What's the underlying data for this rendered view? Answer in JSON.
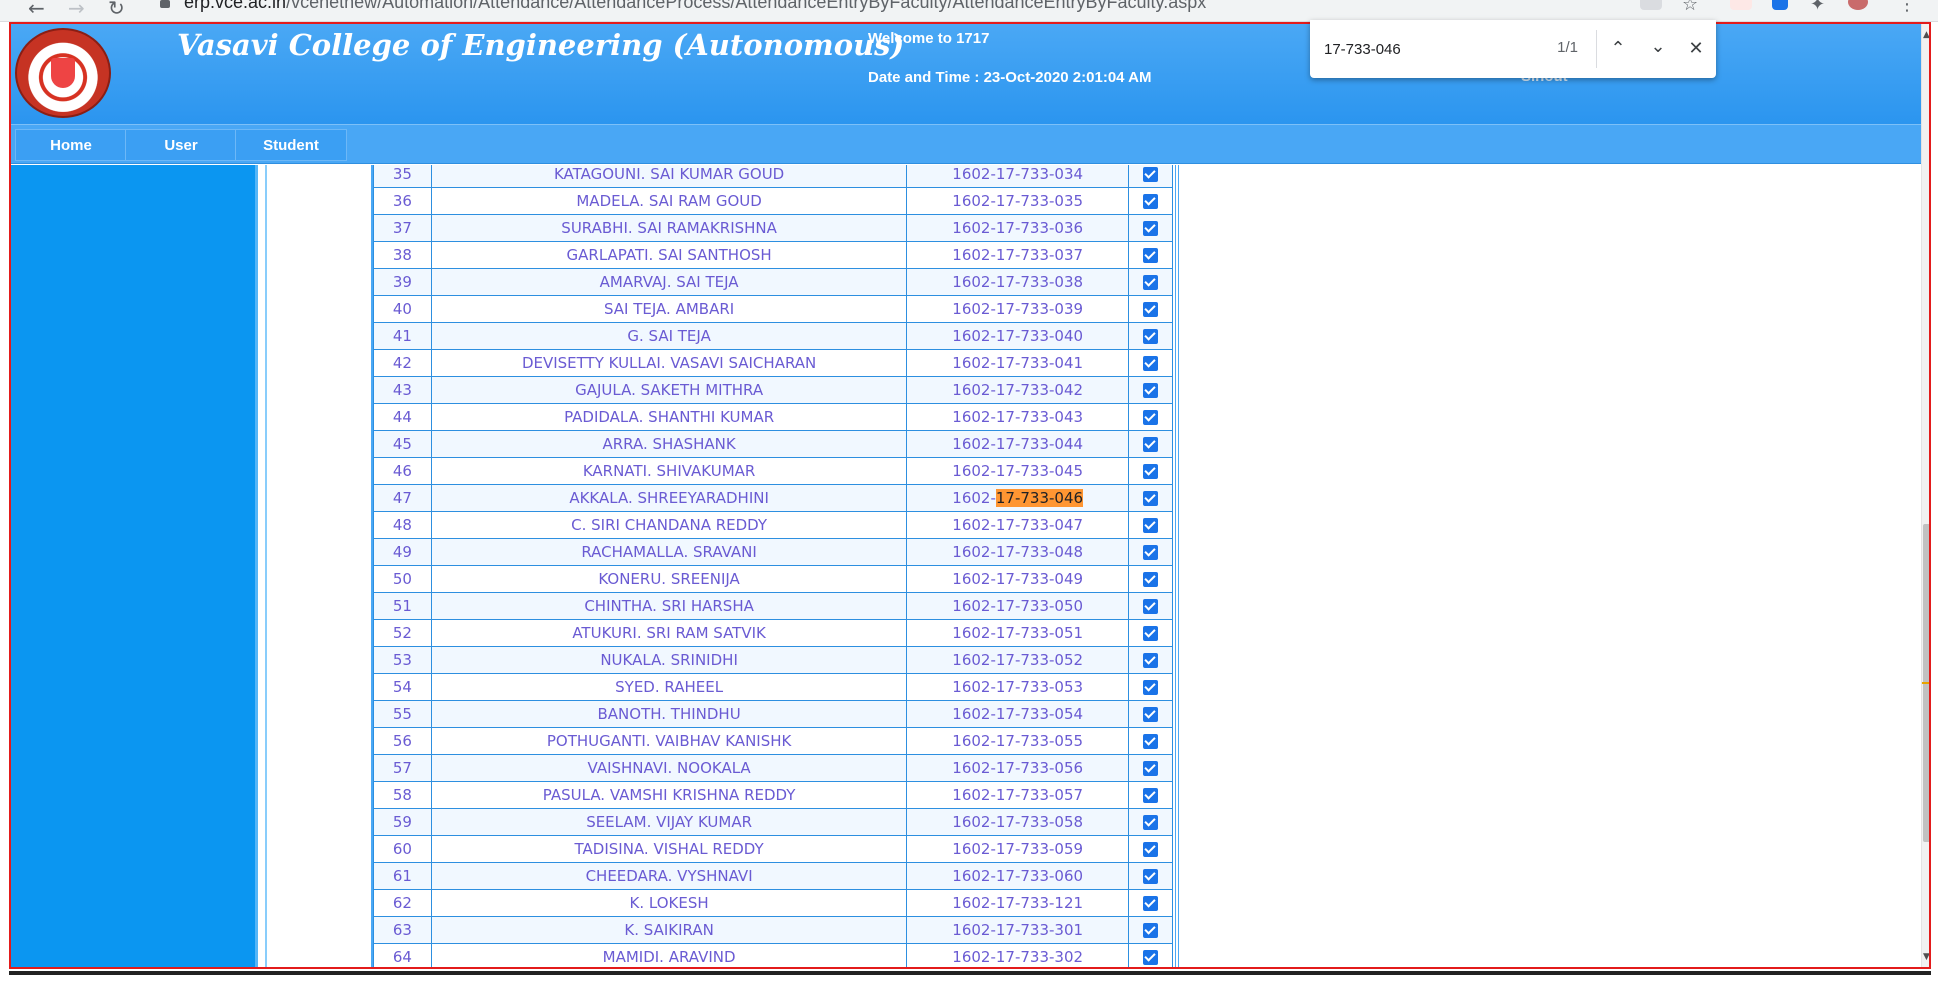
{
  "browser": {
    "url_host": "erp.vce.ac.in",
    "url_path": "/vcenetnew/Automation/Attendance/AttendanceProcess/AttendanceEntryByFaculty/AttendanceEntryByFaculty.aspx",
    "back_icon": "arrow-left-icon",
    "forward_icon": "arrow-right-icon",
    "reload_icon": "reload-icon"
  },
  "header": {
    "college_name": "Vasavi College of Engineering (Autonomous)",
    "welcome": "Welcome to 1717",
    "datetime": "Date and Time : 23-Oct-2020 2:01:04 AM",
    "signout_partial": "Sinout"
  },
  "nav": {
    "items": [
      {
        "label": "Home"
      },
      {
        "label": "User"
      },
      {
        "label": "Student"
      }
    ]
  },
  "find_bar": {
    "query": "17-733-046",
    "count": "1/1",
    "prev_icon": "chevron-up-icon",
    "next_icon": "chevron-down-icon",
    "close_icon": "close-icon"
  },
  "attendance": {
    "highlight_query": "17-733-046",
    "rows": [
      {
        "sno": "35",
        "name": "KATAGOUNI. SAI KUMAR GOUD",
        "roll": "1602-17-733-034",
        "present": true
      },
      {
        "sno": "36",
        "name": "MADELA. SAI RAM GOUD",
        "roll": "1602-17-733-035",
        "present": true
      },
      {
        "sno": "37",
        "name": "SURABHI. SAI RAMAKRISHNA",
        "roll": "1602-17-733-036",
        "present": true
      },
      {
        "sno": "38",
        "name": "GARLAPATI. SAI SANTHOSH",
        "roll": "1602-17-733-037",
        "present": true
      },
      {
        "sno": "39",
        "name": "AMARVAJ. SAI TEJA",
        "roll": "1602-17-733-038",
        "present": true
      },
      {
        "sno": "40",
        "name": "SAI TEJA. AMBARI",
        "roll": "1602-17-733-039",
        "present": true
      },
      {
        "sno": "41",
        "name": "G. SAI TEJA",
        "roll": "1602-17-733-040",
        "present": true
      },
      {
        "sno": "42",
        "name": "DEVISETTY KULLAI. VASAVI SAICHARAN",
        "roll": "1602-17-733-041",
        "present": true
      },
      {
        "sno": "43",
        "name": "GAJULA. SAKETH MITHRA",
        "roll": "1602-17-733-042",
        "present": true
      },
      {
        "sno": "44",
        "name": "PADIDALA. SHANTHI KUMAR",
        "roll": "1602-17-733-043",
        "present": true
      },
      {
        "sno": "45",
        "name": "ARRA. SHASHANK",
        "roll": "1602-17-733-044",
        "present": true
      },
      {
        "sno": "46",
        "name": "KARNATI. SHIVAKUMAR",
        "roll": "1602-17-733-045",
        "present": true
      },
      {
        "sno": "47",
        "name": "AKKALA. SHREEYARADHINI",
        "roll": "1602-17-733-046",
        "present": true
      },
      {
        "sno": "48",
        "name": "C. SIRI CHANDANA REDDY",
        "roll": "1602-17-733-047",
        "present": true
      },
      {
        "sno": "49",
        "name": "RACHAMALLA. SRAVANI",
        "roll": "1602-17-733-048",
        "present": true
      },
      {
        "sno": "50",
        "name": "KONERU. SREENIJA",
        "roll": "1602-17-733-049",
        "present": true
      },
      {
        "sno": "51",
        "name": "CHINTHA. SRI HARSHA",
        "roll": "1602-17-733-050",
        "present": true
      },
      {
        "sno": "52",
        "name": "ATUKURI. SRI RAM SATVIK",
        "roll": "1602-17-733-051",
        "present": true
      },
      {
        "sno": "53",
        "name": "NUKALA. SRINIDHI",
        "roll": "1602-17-733-052",
        "present": true
      },
      {
        "sno": "54",
        "name": "SYED. RAHEEL",
        "roll": "1602-17-733-053",
        "present": true
      },
      {
        "sno": "55",
        "name": "BANOTH. THINDHU",
        "roll": "1602-17-733-054",
        "present": true
      },
      {
        "sno": "56",
        "name": "POTHUGANTI. VAIBHAV KANISHK",
        "roll": "1602-17-733-055",
        "present": true
      },
      {
        "sno": "57",
        "name": "VAISHNAVI. NOOKALA",
        "roll": "1602-17-733-056",
        "present": true
      },
      {
        "sno": "58",
        "name": "PASULA. VAMSHI KRISHNA REDDY",
        "roll": "1602-17-733-057",
        "present": true
      },
      {
        "sno": "59",
        "name": "SEELAM. VIJAY KUMAR",
        "roll": "1602-17-733-058",
        "present": true
      },
      {
        "sno": "60",
        "name": "TADISINA. VISHAL REDDY",
        "roll": "1602-17-733-059",
        "present": true
      },
      {
        "sno": "61",
        "name": "CHEEDARA. VYSHNAVI",
        "roll": "1602-17-733-060",
        "present": true
      },
      {
        "sno": "62",
        "name": "K. LOKESH",
        "roll": "1602-17-733-121",
        "present": true
      },
      {
        "sno": "63",
        "name": "K. SAIKIRAN",
        "roll": "1602-17-733-301",
        "present": true
      },
      {
        "sno": "64",
        "name": "MAMIDI. ARAVIND",
        "roll": "1602-17-733-302",
        "present": true
      }
    ]
  },
  "colors": {
    "header_blue": "#2b95ef",
    "sidebar_blue": "#0b96f1",
    "row_text": "#6a5bd3",
    "find_highlight": "#ff9632",
    "frame_red": "#e31b1b"
  }
}
